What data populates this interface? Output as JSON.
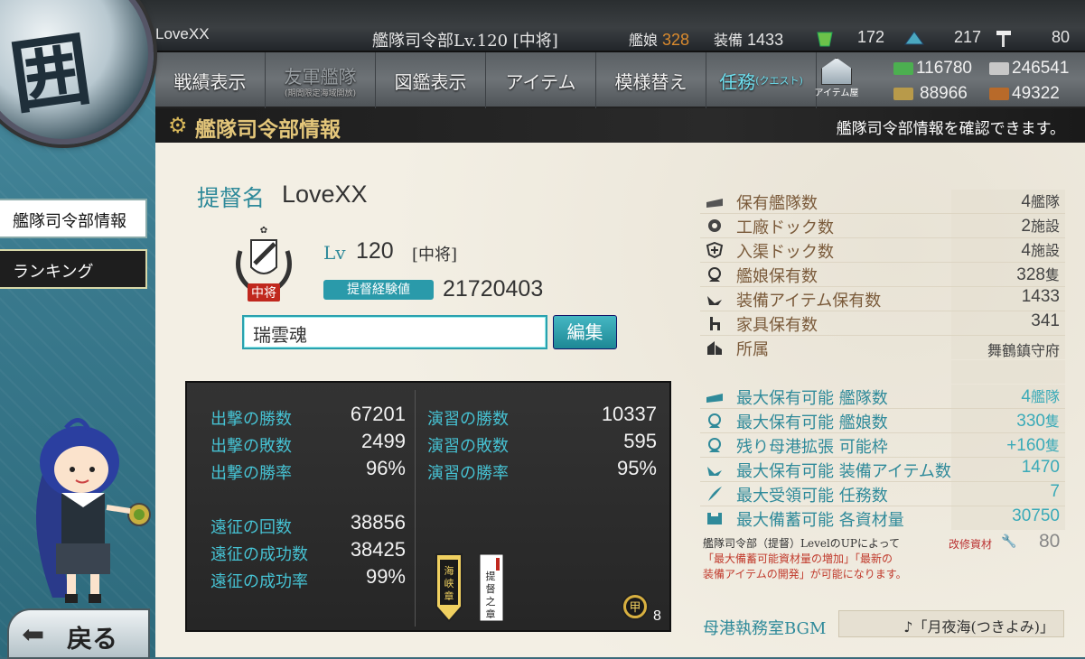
{
  "player": {
    "name": "LoveXX"
  },
  "header": {
    "hq_level_text": "艦隊司令部Lv.120 [中将]",
    "ships_label": "艦娘",
    "ships_count": "328",
    "equip_label": "装備",
    "equip_count": "1433",
    "bucket_count": "172",
    "devmat_count": "217",
    "screw_count": "80"
  },
  "nav": {
    "items": [
      {
        "label": "戦績表示"
      },
      {
        "label": "友軍艦隊",
        "sub": "(期間限定海域開放)"
      },
      {
        "label": "図鑑表示"
      },
      {
        "label": "アイテム"
      },
      {
        "label": "模様替え"
      },
      {
        "label": "任務",
        "sub": "(クエスト)"
      }
    ],
    "shop_label": "アイテム屋"
  },
  "resources": {
    "fuel": "116780",
    "ammo": "246541",
    "steel": "88966",
    "bauxite": "49322"
  },
  "titlebar": {
    "title": "艦隊司令部情報",
    "desc": "艦隊司令部情報を確認できます。"
  },
  "sidebar": {
    "items": [
      {
        "label": "艦隊司令部情報"
      },
      {
        "label": "ランキング"
      }
    ]
  },
  "profile": {
    "admiral_label": "提督名",
    "admiral_name": "LoveXX",
    "lv_label": "Lv",
    "lv_value": "120",
    "rank": "[中将]",
    "rank_badge": "中将",
    "exp_label": "提督経験値",
    "exp_value": "21720403",
    "comment": "瑞雲魂",
    "edit_label": "編集"
  },
  "record": {
    "left": [
      {
        "label": "出撃の勝数",
        "value": "67201"
      },
      {
        "label": "出撃の敗数",
        "value": "2499"
      },
      {
        "label": "出撃の勝率",
        "value": "96%"
      },
      {
        "label": "遠征の回数",
        "value": "38856"
      },
      {
        "label": "遠征の成功数",
        "value": "38425"
      },
      {
        "label": "遠征の成功率",
        "value": "99%"
      }
    ],
    "right": [
      {
        "label": "演習の勝数",
        "value": "10337"
      },
      {
        "label": "演習の敗数",
        "value": "595"
      },
      {
        "label": "演習の勝率",
        "value": "95%"
      }
    ],
    "medal_count": "8",
    "medal_text_1": "海峡章",
    "medal_text_2": "提督之章",
    "medal_kou": "甲"
  },
  "info": {
    "rows": [
      {
        "label": "保有艦隊数",
        "value": "4",
        "unit": "艦隊"
      },
      {
        "label": "工廠ドック数",
        "value": "2",
        "unit": "施設"
      },
      {
        "label": "入渠ドック数",
        "value": "4",
        "unit": "施設"
      },
      {
        "label": "艦娘保有数",
        "value": "328",
        "unit": "隻"
      },
      {
        "label": "装備アイテム保有数",
        "value": "1433",
        "unit": ""
      },
      {
        "label": "家具保有数",
        "value": "341",
        "unit": ""
      },
      {
        "label": "所属",
        "value": "舞鶴鎮守府",
        "unit": ""
      }
    ],
    "max_rows": [
      {
        "label": "最大保有可能 艦隊数",
        "value": "4",
        "unit": "艦隊"
      },
      {
        "label": "最大保有可能 艦娘数",
        "value": "330",
        "unit": "隻"
      },
      {
        "label": "残り母港拡張 可能枠",
        "value": "+160",
        "unit": "隻"
      },
      {
        "label": "最大保有可能 装備アイテム数",
        "value": "1470",
        "unit": ""
      },
      {
        "label": "最大受領可能 任務数",
        "value": "7",
        "unit": ""
      },
      {
        "label": "最大備蓄可能 各資材量",
        "value": "30750",
        "unit": ""
      }
    ],
    "note_1": "艦隊司令部（提督）LevelのUPによって",
    "note_2": "「最大備蓄可能資材量の増加」「最新の",
    "note_3": "装備アイテムの開発」が可能になります。",
    "kaishu_label": "改修資材",
    "kaishu_value": "80",
    "bgm_label": "母港執務室BGM",
    "bgm_value": "♪「月夜海(つきよみ)」"
  },
  "back_label": "戻る",
  "colors": {
    "teal": "#2f8a9a",
    "gold": "#e3c67a",
    "orange": "#d98a2e"
  }
}
